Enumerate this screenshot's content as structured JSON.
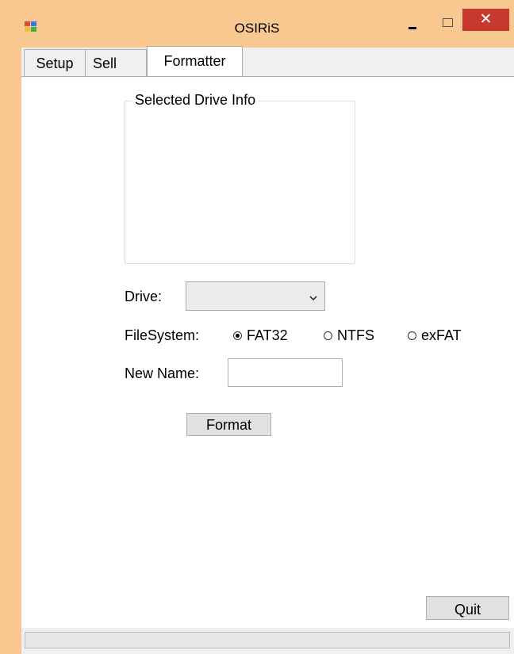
{
  "window": {
    "title": "OSIRiS",
    "close_glyph": "✕"
  },
  "tabs": [
    {
      "label": "Setup"
    },
    {
      "label": "Sell"
    },
    {
      "label": "Formatter",
      "active": true
    }
  ],
  "formatter": {
    "drive_info_label": "Selected Drive Info",
    "drive_label": "Drive:",
    "drive_value": "",
    "filesystem_label": "FileSystem:",
    "filesystem_options": [
      {
        "label": "FAT32",
        "checked": true
      },
      {
        "label": "NTFS",
        "checked": false
      },
      {
        "label": "exFAT",
        "checked": false
      }
    ],
    "new_name_label": "New Name:",
    "new_name_value": "",
    "format_button": "Format"
  },
  "footer": {
    "quit_button": "Quit",
    "progress": 0
  },
  "colors": {
    "title_bar": "#f8c890",
    "close_button": "#c7392f"
  }
}
